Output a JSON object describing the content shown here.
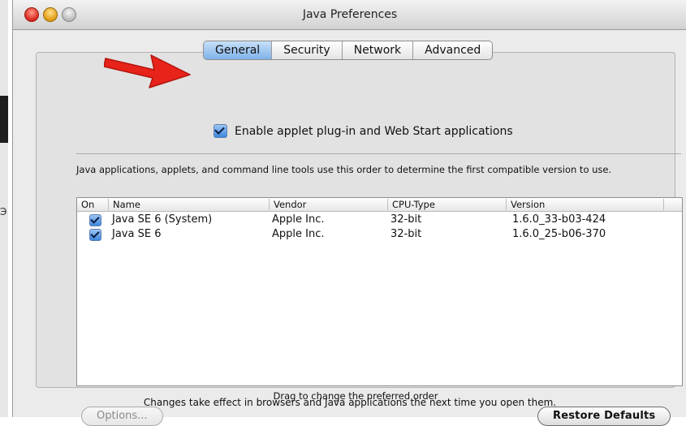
{
  "background": {
    "glyph": "Э"
  },
  "window": {
    "title": "Java Preferences"
  },
  "tabs": [
    {
      "label": "General",
      "active": true
    },
    {
      "label": "Security",
      "active": false
    },
    {
      "label": "Network",
      "active": false
    },
    {
      "label": "Advanced",
      "active": false
    }
  ],
  "enable_applet": {
    "label": "Enable applet plug-in and Web Start applications",
    "checked": true
  },
  "description": "Java applications, applets, and command line tools use this order to determine the first compatible version to use.",
  "table": {
    "headers": [
      "On",
      "Name",
      "Vendor",
      "CPU-Type",
      "Version"
    ],
    "rows": [
      {
        "on": true,
        "name": "Java SE 6 (System)",
        "vendor": "Apple Inc.",
        "cpu": "32-bit",
        "version": "1.6.0_33-b03-424"
      },
      {
        "on": true,
        "name": "Java SE 6",
        "vendor": "Apple Inc.",
        "cpu": "32-bit",
        "version": "1.6.0_25-b06-370"
      }
    ]
  },
  "drag_hint": "Drag to change the preferred order",
  "buttons": {
    "options": "Options...",
    "restore": "Restore Defaults"
  },
  "footer": "Changes take effect in browsers and Java applications the next time you open them.",
  "colors": {
    "arrow": "#e8231a",
    "tab_active": "#7fb2ea"
  }
}
